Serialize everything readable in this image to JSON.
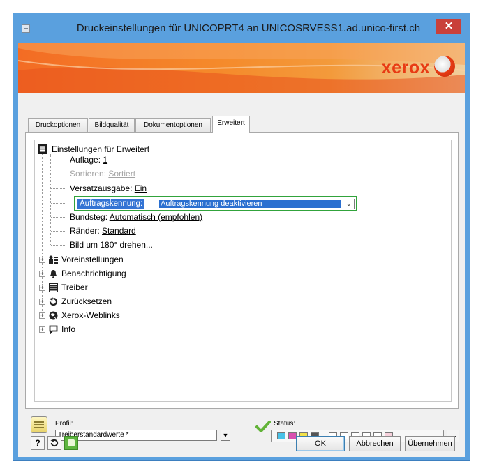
{
  "window": {
    "title": "Druckeinstellungen für UNICOPRT4 an UNICOSRVESS1.ad.unico-first.ch",
    "close_label": "✕"
  },
  "banner": {
    "brand": "xerox",
    "brand_mark": "®"
  },
  "tabs": [
    {
      "label": "Druckoptionen",
      "active": false
    },
    {
      "label": "Bildqualität",
      "active": false
    },
    {
      "label": "Dokumentoptionen",
      "active": false
    },
    {
      "label": "Erweitert",
      "active": true
    }
  ],
  "tree": {
    "root": {
      "label": "Einstellungen für Erweitert",
      "icon": "printer-settings-icon"
    },
    "settings": [
      {
        "label": "Auflage: ",
        "value": "1",
        "disabled": false
      },
      {
        "label": "Sortieren: ",
        "value": "Sortiert",
        "disabled": true
      },
      {
        "label": "Versatzausgabe: ",
        "value": "Ein",
        "disabled": false
      },
      {
        "label": "Auftragskennung: ",
        "value": "Auftragskennung deaktivieren",
        "disabled": false,
        "selected": true
      },
      {
        "label": "Bundsteg: ",
        "value": "Automatisch (empfohlen)",
        "disabled": false
      },
      {
        "label": "Ränder: ",
        "value": "Standard",
        "disabled": false
      },
      {
        "label": "Bild um 180° drehen...",
        "value": "",
        "disabled": false
      }
    ],
    "categories": [
      {
        "label": "Voreinstellungen",
        "icon": "presets-icon"
      },
      {
        "label": "Benachrichtigung",
        "icon": "bell-icon"
      },
      {
        "label": "Treiber",
        "icon": "driver-icon"
      },
      {
        "label": "Zurücksetzen",
        "icon": "reset-icon"
      },
      {
        "label": "Xerox-Weblinks",
        "icon": "globe-icon"
      },
      {
        "label": "Info",
        "icon": "info-bubble-icon"
      }
    ]
  },
  "profile": {
    "label": "Profil:",
    "value": "Treiberstandardwerte *"
  },
  "status": {
    "label": "Status:"
  },
  "buttons": {
    "help": "?",
    "ok": "OK",
    "cancel": "Abbrechen",
    "apply": "Übernehmen",
    "more": "..."
  },
  "colors": {
    "title_bar": "#5aa0de",
    "close": "#c9403a",
    "brand": "#e83b14",
    "selection": "#3474d4",
    "highlight_border": "#31a33b"
  }
}
